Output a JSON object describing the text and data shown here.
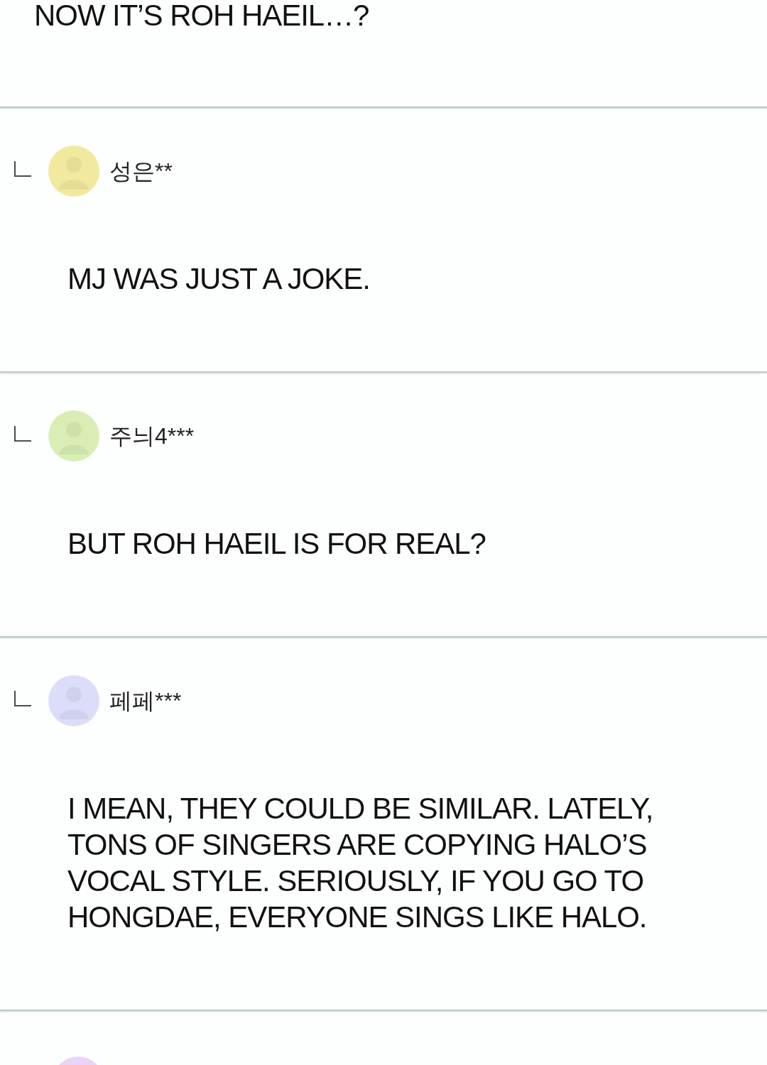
{
  "previous_comment": {
    "text": "NOW IT’S ROH HAEIL…?"
  },
  "replies": [
    {
      "username": "성은**",
      "color": "#f1e99e",
      "text": "MJ WAS JUST A JOKE."
    },
    {
      "username": "주늬4***",
      "color": "#d9eeb4",
      "text": "BUT ROH HAEIL IS FOR REAL?"
    },
    {
      "username": "페페***",
      "color": "#dcdef9",
      "text": "I MEAN, THEY COULD BE SIMILAR. LATELY, TONS OF SINGERS ARE COPYING HALO’S VOCAL STYLE. SERIOUSLY, IF YOU GO TO HONGDAE, EVERYONE SINGS LIKE HALO."
    }
  ],
  "next_reply_partial": {
    "color": "#e7d4f8"
  }
}
